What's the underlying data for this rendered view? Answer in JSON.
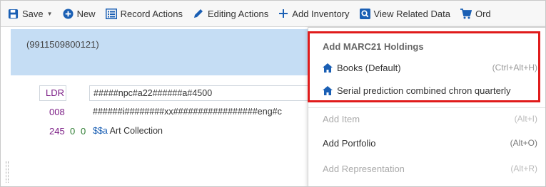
{
  "toolbar": {
    "save_label": "Save",
    "new_label": "New",
    "record_actions_label": "Record Actions",
    "editing_actions_label": "Editing Actions",
    "add_inventory_label": "Add Inventory",
    "view_related_label": "View Related Data",
    "orders_label": "Ord"
  },
  "record": {
    "id": "(9911509800121)",
    "fields": [
      {
        "tag": "LDR",
        "ind1": "",
        "ind2": "",
        "value": "#####npc#a22######a#4500"
      },
      {
        "tag": "008",
        "ind1": "",
        "ind2": "",
        "value": "######i########xx#################eng#c"
      },
      {
        "tag": "245",
        "ind1": "0",
        "ind2": "0",
        "subfield": "$$a",
        "value": "Art Collection"
      }
    ]
  },
  "menu": {
    "section_title": "Add MARC21 Holdings",
    "items": [
      {
        "label": "Books (Default)",
        "shortcut": "(Ctrl+Alt+H)",
        "icon": "home-icon",
        "enabled": true
      },
      {
        "label": "Serial prediction combined chron quarterly",
        "shortcut": "",
        "icon": "home-icon",
        "enabled": true
      },
      {
        "label": "Add Item",
        "shortcut": "(Alt+I)",
        "enabled": false
      },
      {
        "label": "Add Portfolio",
        "shortcut": "(Alt+O)",
        "enabled": true
      },
      {
        "label": "Add Representation",
        "shortcut": "(Alt+R)",
        "enabled": false
      }
    ]
  },
  "colors": {
    "accent_blue": "#1a5fb4",
    "header_band": "#c5ddf4",
    "highlight_red": "#e01b1b",
    "tag_purple": "#7b1c85",
    "indicator_green": "#2e7d32"
  }
}
